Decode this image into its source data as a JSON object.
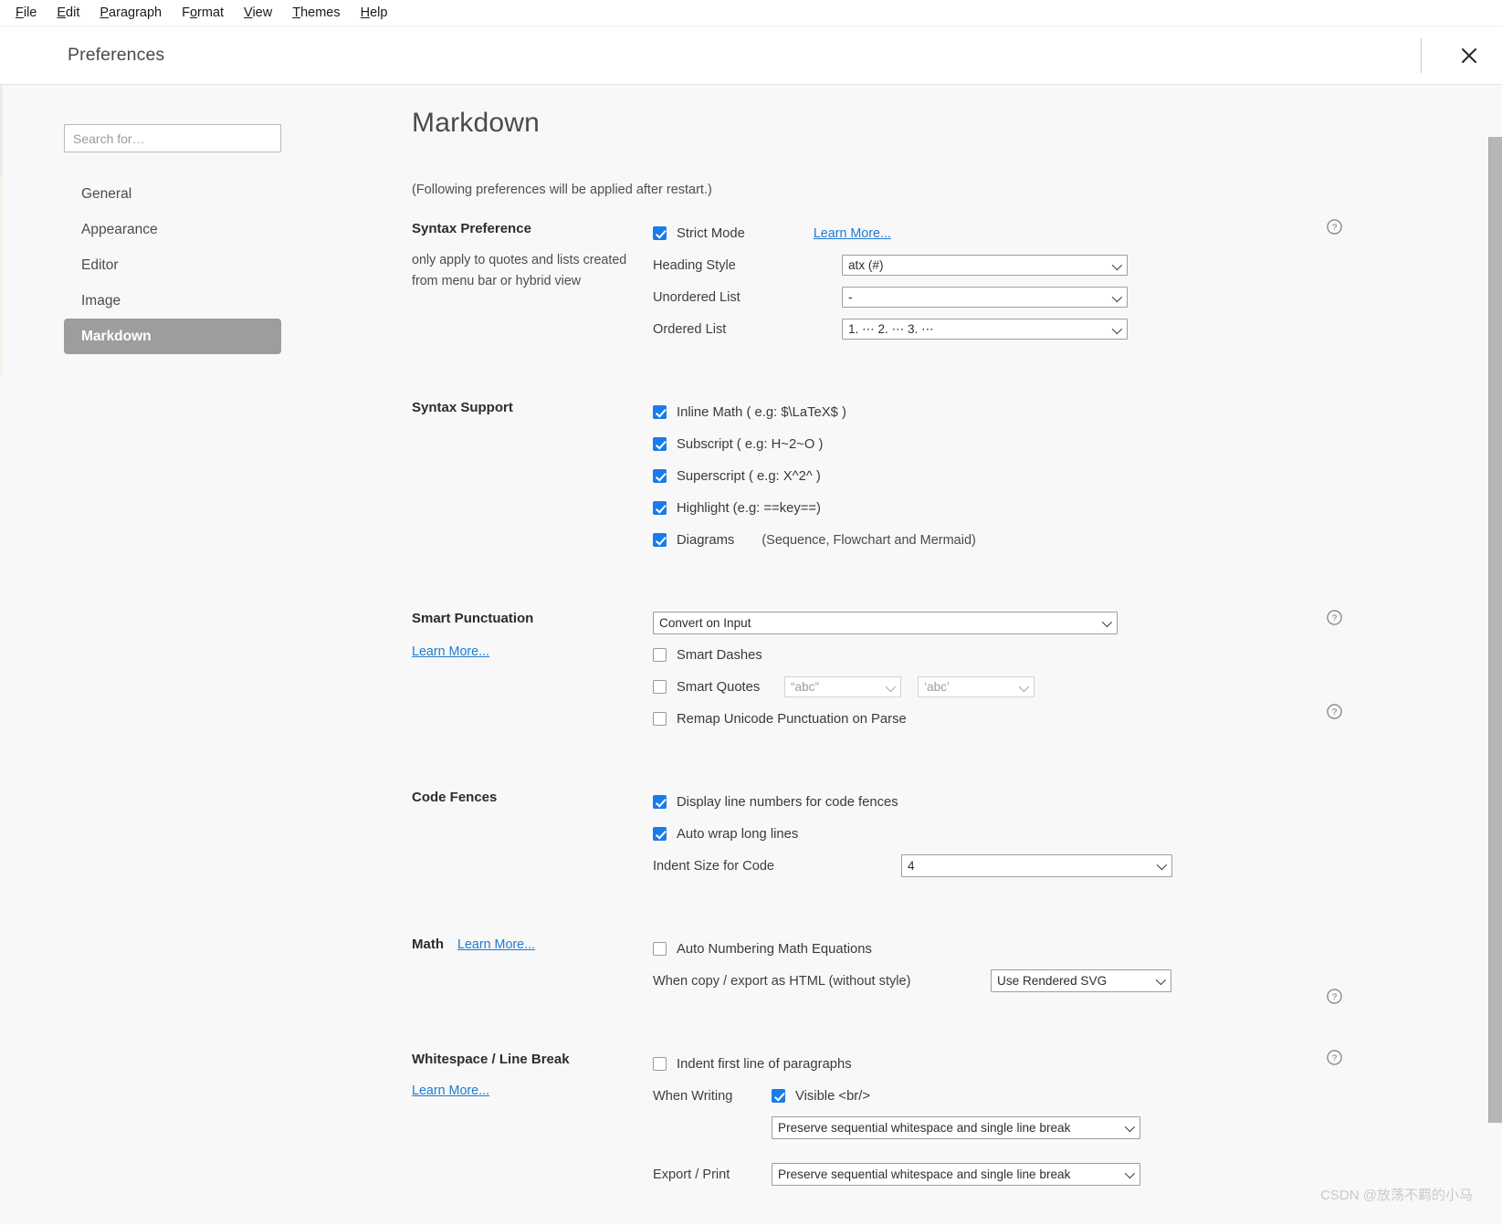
{
  "menubar": {
    "items": [
      {
        "label": "File",
        "accel": "F"
      },
      {
        "label": "Edit",
        "accel": "E"
      },
      {
        "label": "Paragraph",
        "accel": "P"
      },
      {
        "label": "Format",
        "accel": "o"
      },
      {
        "label": "View",
        "accel": "V"
      },
      {
        "label": "Themes",
        "accel": "T"
      },
      {
        "label": "Help",
        "accel": "H"
      }
    ]
  },
  "titlebar": {
    "title": "Preferences",
    "close_icon": "close-icon"
  },
  "sidebar": {
    "search": {
      "placeholder": "Search for…",
      "value": ""
    },
    "items": [
      {
        "label": "General",
        "active": false
      },
      {
        "label": "Appearance",
        "active": false
      },
      {
        "label": "Editor",
        "active": false
      },
      {
        "label": "Image",
        "active": false
      },
      {
        "label": "Markdown",
        "active": true
      }
    ]
  },
  "main": {
    "page_title": "Markdown",
    "restart_note": "(Following preferences will be applied after restart.)",
    "sections": {
      "syntax_preference": {
        "title": "Syntax Preference",
        "subtitle": "only apply to quotes and lists created from menu bar or hybrid view",
        "strict_mode": {
          "label": "Strict Mode",
          "checked": true
        },
        "learn_more": "Learn More...",
        "heading_style": {
          "label": "Heading Style",
          "value": "atx (#)"
        },
        "unordered_list": {
          "label": "Unordered List",
          "value": "-"
        },
        "ordered_list": {
          "label": "Ordered List",
          "value": "1. ⋯ 2. ⋯ 3. ⋯"
        },
        "help_icon": "help-circle-icon"
      },
      "syntax_support": {
        "title": "Syntax Support",
        "options": [
          {
            "label": "Inline Math ( e.g: $\\LaTeX$ )",
            "checked": true
          },
          {
            "label": "Subscript ( e.g: H~2~O )",
            "checked": true
          },
          {
            "label": "Superscript ( e.g: X^2^ )",
            "checked": true
          },
          {
            "label": "Highlight (e.g: ==key==)",
            "checked": true
          },
          {
            "label": "Diagrams",
            "checked": true,
            "note": "(Sequence, Flowchart and Mermaid)"
          }
        ]
      },
      "smart_punctuation": {
        "title": "Smart Punctuation",
        "learn_more": "Learn More...",
        "mode": {
          "value": "Convert on Input"
        },
        "smart_dashes": {
          "label": "Smart Dashes",
          "checked": false
        },
        "smart_quotes": {
          "label": "Smart Quotes",
          "checked": false,
          "double": "“abc”",
          "single": "‘abc’"
        },
        "remap_unicode": {
          "label": "Remap Unicode Punctuation on Parse",
          "checked": false
        },
        "help_icon_top": "help-circle-icon",
        "help_icon_bottom": "help-circle-icon"
      },
      "code_fences": {
        "title": "Code Fences",
        "line_numbers": {
          "label": "Display line numbers for code fences",
          "checked": true
        },
        "auto_wrap": {
          "label": "Auto wrap long lines",
          "checked": true
        },
        "indent_size": {
          "label": "Indent Size for Code",
          "value": "4"
        }
      },
      "math": {
        "title": "Math",
        "learn_more": "Learn More...",
        "auto_numbering": {
          "label": "Auto Numbering Math Equations",
          "checked": false
        },
        "copy_export": {
          "label": "When copy / export as HTML (without style)",
          "value": "Use Rendered SVG"
        },
        "help_icon": "help-circle-icon"
      },
      "whitespace": {
        "title": "Whitespace / Line Break",
        "learn_more": "Learn More...",
        "indent_first_line": {
          "label": "Indent first line of paragraphs",
          "checked": false
        },
        "when_writing": {
          "label": "When Writing",
          "visible_br": {
            "label": "Visible <br/>",
            "checked": true
          },
          "value": "Preserve sequential whitespace and single line break"
        },
        "export_print": {
          "label": "Export / Print",
          "value": "Preserve sequential whitespace and single line break"
        },
        "help_icon": "help-circle-icon"
      }
    }
  },
  "watermark": "CSDN @放荡不羁的小马",
  "colors": {
    "accent": "#1a7bea",
    "link": "#1f7ad3",
    "active_nav_bg": "#9d9d9d",
    "page_bg": "#f8f8f8"
  }
}
